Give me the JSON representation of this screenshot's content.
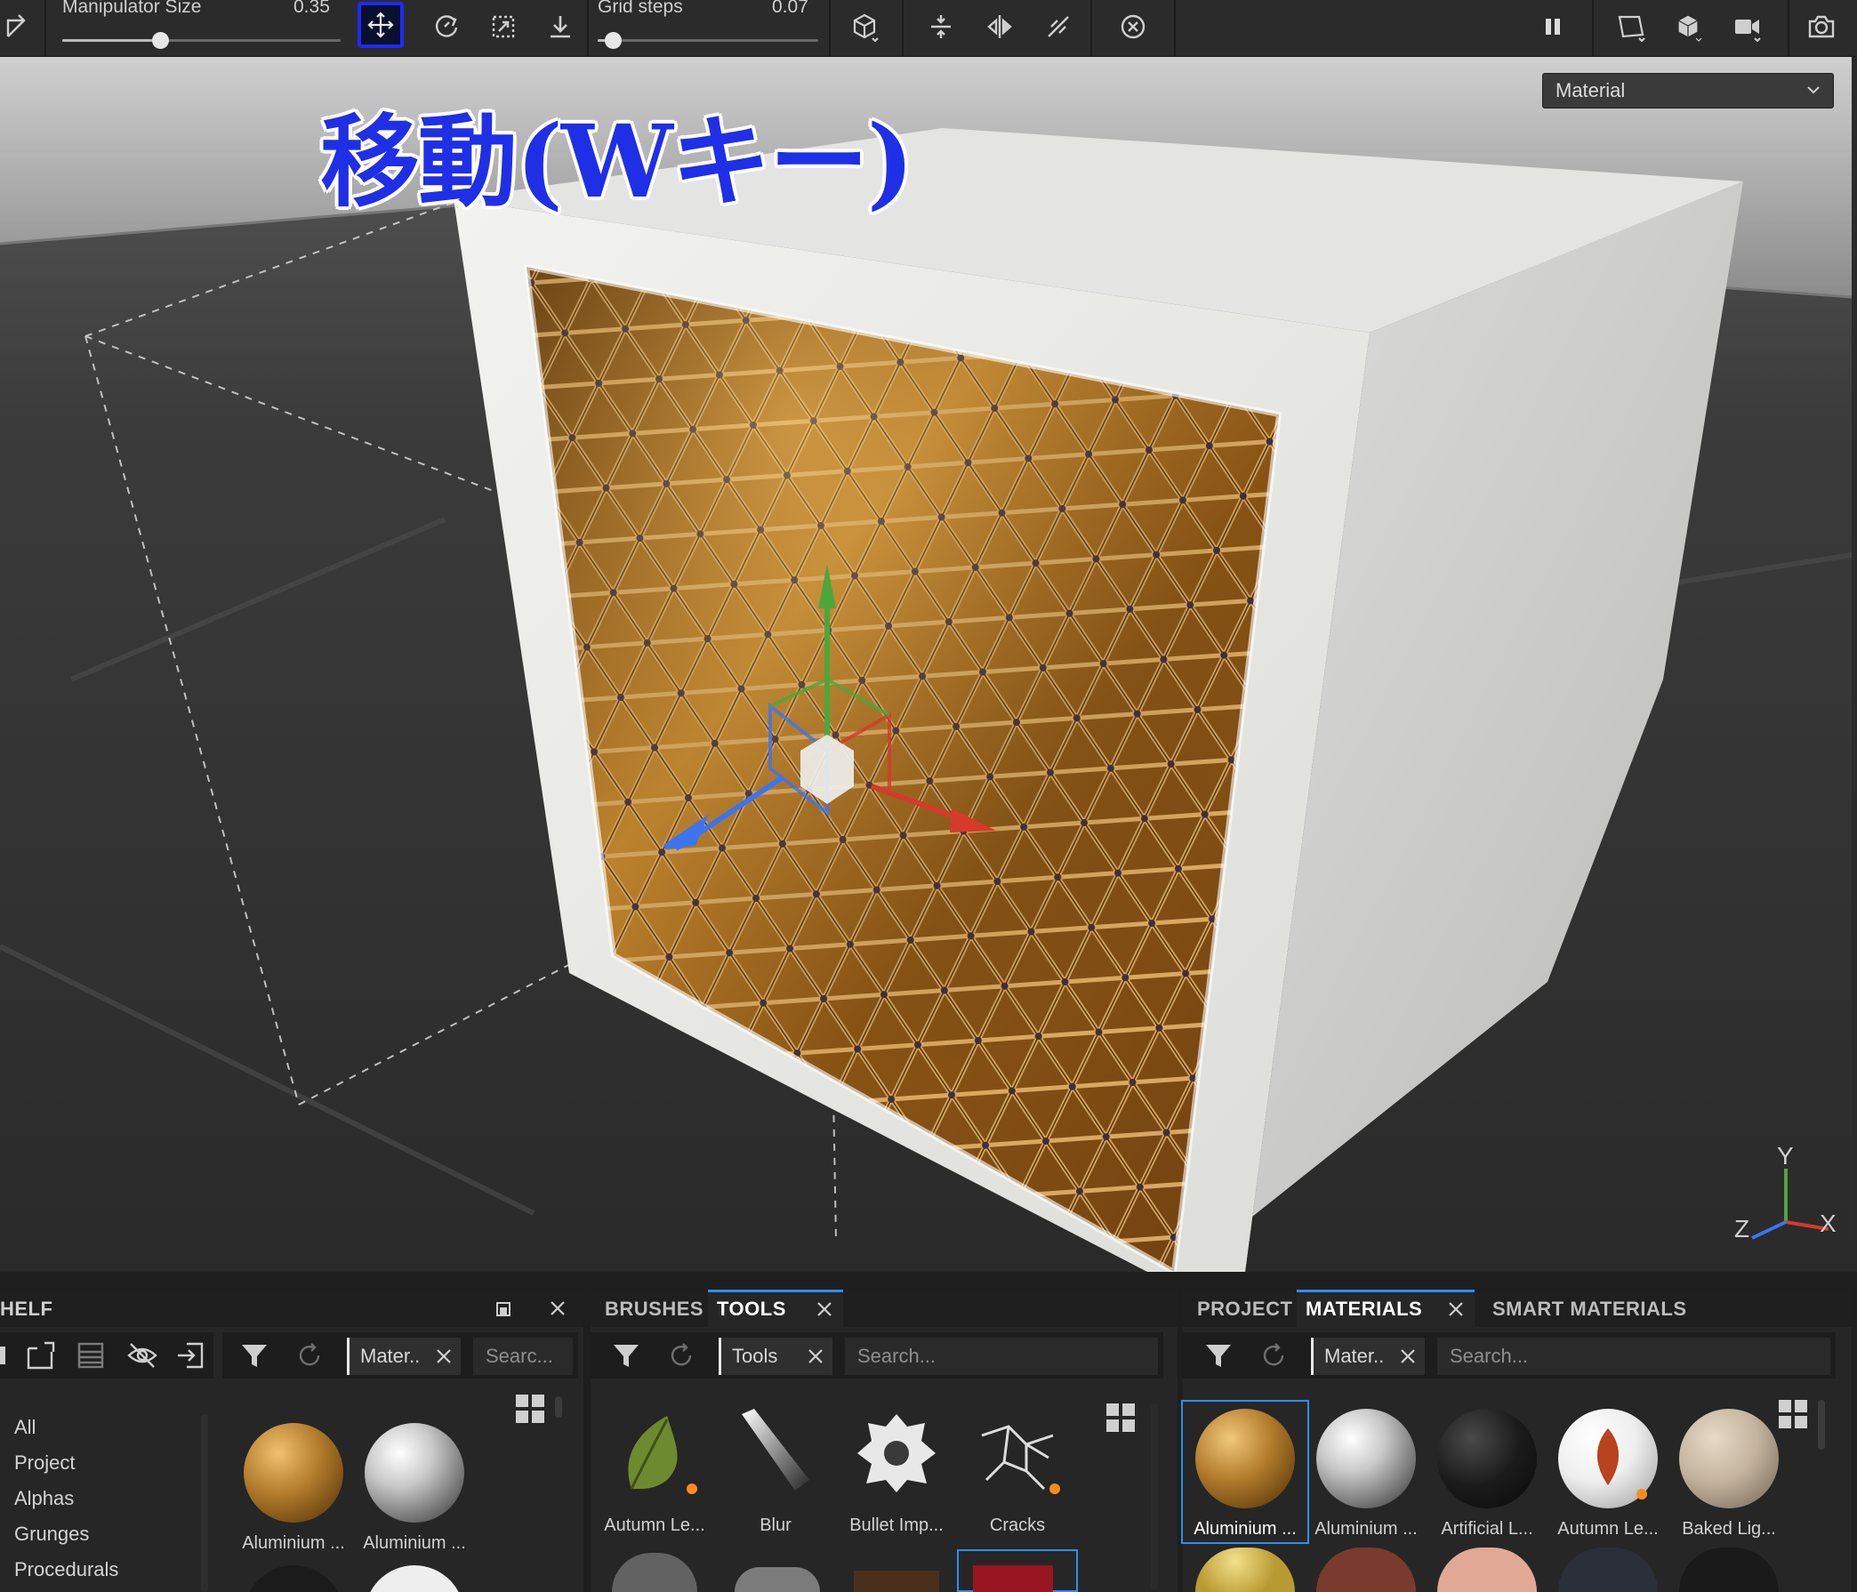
{
  "toolbar": {
    "manipulator_label": "Manipulator Size",
    "manipulator_value": "0.35",
    "manipulator_fraction": 0.35,
    "grid_label": "Grid steps",
    "grid_value": "0.07",
    "grid_fraction": 0.07,
    "active_tool": "move",
    "accent_color": "#1a2cff"
  },
  "viewport": {
    "annotation": "移動(Wキー)",
    "channel_select": "Material",
    "axis": {
      "x": "X",
      "y": "Y",
      "z": "Z"
    }
  },
  "shelf": {
    "title": "HELF",
    "filter_chip": "Mater..",
    "search_placeholder": "Searc...",
    "categories": [
      "All",
      "Project",
      "Alphas",
      "Grunges",
      "Procedurals"
    ],
    "items": [
      {
        "name": "Aluminium ...",
        "color": "#b07a2a"
      },
      {
        "name": "Aluminium ...",
        "color": "#c9c9c9"
      }
    ]
  },
  "tools_panel": {
    "tabs": [
      "BRUSHES",
      "TOOLS"
    ],
    "active_tab": "TOOLS",
    "filter_chip": "Tools",
    "search_placeholder": "Search...",
    "items": [
      {
        "name": "Autumn Le...",
        "icon": "leaf-icon"
      },
      {
        "name": "Blur",
        "icon": "blur-icon"
      },
      {
        "name": "Bullet Imp...",
        "icon": "bullet-impact-icon"
      },
      {
        "name": "Cracks",
        "icon": "cracks-icon"
      }
    ]
  },
  "materials_panel": {
    "tabs": [
      "PROJECT",
      "MATERIALS",
      "SMART MATERIALS"
    ],
    "active_tab": "MATERIALS",
    "filter_chip": "Mater..",
    "search_placeholder": "Search...",
    "items": [
      {
        "name": "Aluminium ...",
        "color": "#b07a2a"
      },
      {
        "name": "Aluminium ...",
        "color": "#c9c9c9"
      },
      {
        "name": "Artificial L...",
        "color": "#1b1b1b"
      },
      {
        "name": "Autumn Le...",
        "color": "#eeeeee"
      },
      {
        "name": "Baked Lig...",
        "color": "#c4b49f"
      }
    ]
  }
}
